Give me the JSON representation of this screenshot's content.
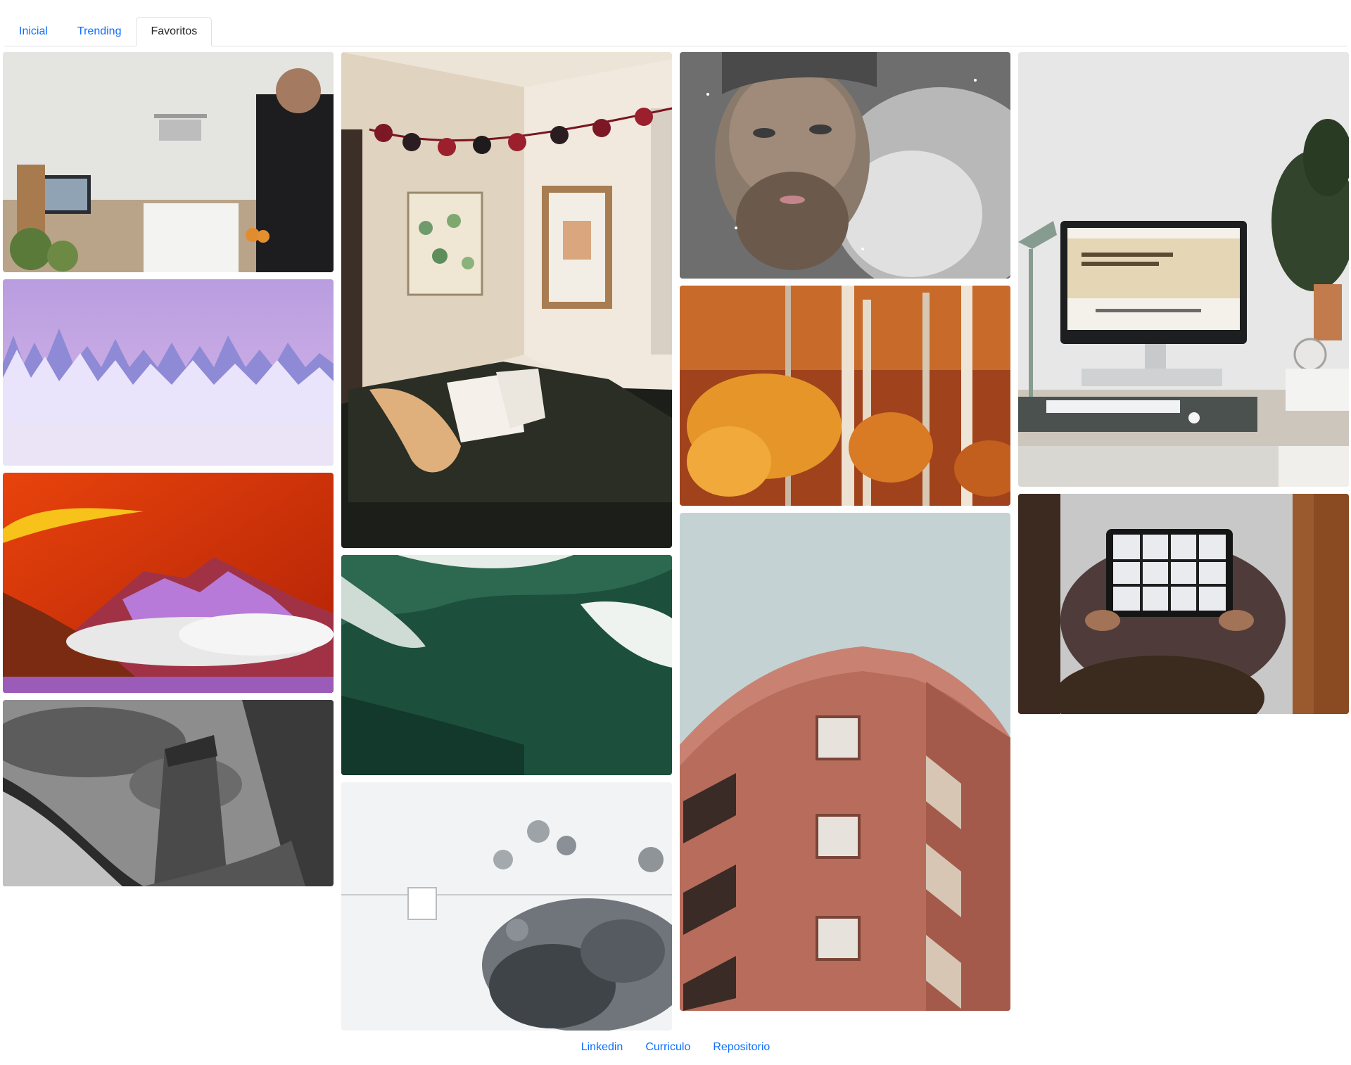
{
  "tabs": [
    {
      "label": "Inicial",
      "active": false
    },
    {
      "label": "Trending",
      "active": false
    },
    {
      "label": "Favoritos",
      "active": true
    }
  ],
  "footer": {
    "links": [
      "Linkedin",
      "Curriculo",
      "Repositorio"
    ]
  },
  "colors": {
    "link": "#0d6efd",
    "active_tab_text": "#212529",
    "border": "#dee2e6"
  },
  "gallery": {
    "columns": [
      {
        "photos": [
          {
            "subject": "person-in-kitchen-with-laptop"
          },
          {
            "subject": "snowy-forest-purple-sky"
          },
          {
            "subject": "red-sky-purple-mountain"
          },
          {
            "subject": "black-white-skyscrapers"
          }
        ]
      },
      {
        "photos": [
          {
            "subject": "cozy-room-corner-with-sofa"
          },
          {
            "subject": "aerial-ocean-waves"
          },
          {
            "subject": "aerial-snowy-landscape"
          }
        ]
      },
      {
        "photos": [
          {
            "subject": "bearded-man-in-snow"
          },
          {
            "subject": "autumn-birch-forest"
          },
          {
            "subject": "red-brick-building"
          }
        ]
      },
      {
        "photos": [
          {
            "subject": "desk-with-computer-monitor"
          },
          {
            "subject": "person-holding-tablet"
          }
        ]
      }
    ]
  }
}
